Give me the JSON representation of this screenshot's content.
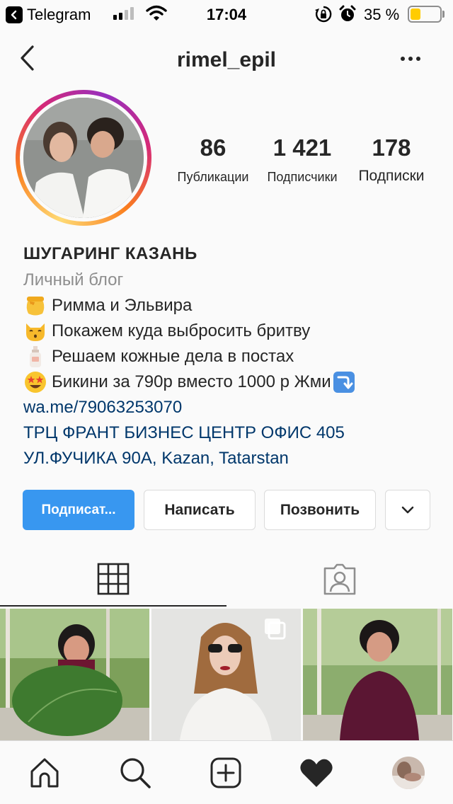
{
  "status_bar": {
    "back_app": "Telegram",
    "time": "17:04",
    "battery_percent": "35 %",
    "battery_level": 0.35,
    "battery_color": "#ffcc00"
  },
  "header": {
    "username": "rimel_epil",
    "back_icon": "chevron-left-icon",
    "more_icon": "more-horizontal-icon"
  },
  "profile": {
    "stats": [
      {
        "value": "86",
        "label": "Публикации"
      },
      {
        "value": "1 421",
        "label": "Подписчики"
      },
      {
        "value": "178",
        "label": "Подписки"
      }
    ],
    "name": "ШУГАРИНГ КАЗАНЬ",
    "category": "Личный блог",
    "bio_lines": [
      {
        "icon": "honey-pot-emoji",
        "text": "Римма и Эльвира"
      },
      {
        "icon": "kissing-cat-emoji",
        "text": " Покажем куда выбросить бритву"
      },
      {
        "icon": "lotion-bottle-emoji",
        "text": " Решаем кожные дела в постах"
      },
      {
        "icon": "star-struck-emoji",
        "text": " Бикини за 790р вместо 1000 р Жми"
      }
    ],
    "link": "wa.me/79063253070",
    "address_lines": [
      "ТРЦ ФРАНТ БИЗНЕС ЦЕНТР ОФИС 405",
      "УЛ.ФУЧИКА 90А, Kazan, Tatarstan"
    ]
  },
  "actions": {
    "follow": "Подписат...",
    "message": "Написать",
    "call": "Позвонить",
    "more_icon": "chevron-down-icon"
  },
  "tabs": [
    {
      "icon": "grid-icon",
      "selected": true
    },
    {
      "icon": "tagged-person-icon",
      "selected": false
    }
  ],
  "bottom_nav": [
    {
      "icon": "home-icon"
    },
    {
      "icon": "search-icon"
    },
    {
      "icon": "new-post-icon"
    },
    {
      "icon": "heart-icon"
    },
    {
      "icon": "profile-avatar"
    }
  ],
  "colors": {
    "accent": "#3897f0",
    "link": "#00376b",
    "secondary_text": "#8e8e8e",
    "border": "#dbdbdb"
  }
}
